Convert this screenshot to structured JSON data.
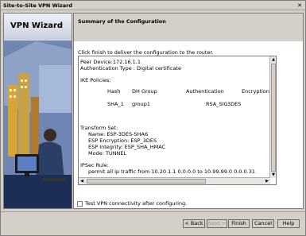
{
  "window": {
    "title": "Site-to-Site VPN Wizard"
  },
  "sidebar": {
    "heading": "VPN Wizard"
  },
  "main": {
    "section_title": "Summary of the Configuration",
    "instruction": "Click finish to deliver the configuration to the router.",
    "summary": {
      "peer_device": "Peer Device:172.16.1.1",
      "auth_type": "Authentication Type : Digital certificate",
      "ike_label": "IKE Policies:",
      "ike_table": {
        "headers": [
          "Hash",
          "DH Group",
          "Authentication",
          "Encryption"
        ],
        "rows": [
          [
            "SHA_1",
            "group1",
            "RSA_SIG",
            "3DES"
          ]
        ]
      },
      "transform_label": "Transform Set:",
      "transform_lines": [
        "Name: ESP-3DES-SHA6",
        "ESP Encryption: ESP_3DES",
        "ESP Integrity: ESP_SHA_HMAC",
        "Mode: TUNNEL"
      ],
      "ipsec_label": "IPSec Rule:",
      "ipsec_rule": "permit all ip traffic from 10.20.1.1 0.0.0.0 to 10.99.99.0 0.0.0.31"
    },
    "checkbox_label": "Test VPN connectivity after configuring."
  },
  "buttons": {
    "back": "< Back",
    "next": "Next >",
    "finish": "Finish",
    "cancel": "Cancel",
    "help": "Help"
  }
}
